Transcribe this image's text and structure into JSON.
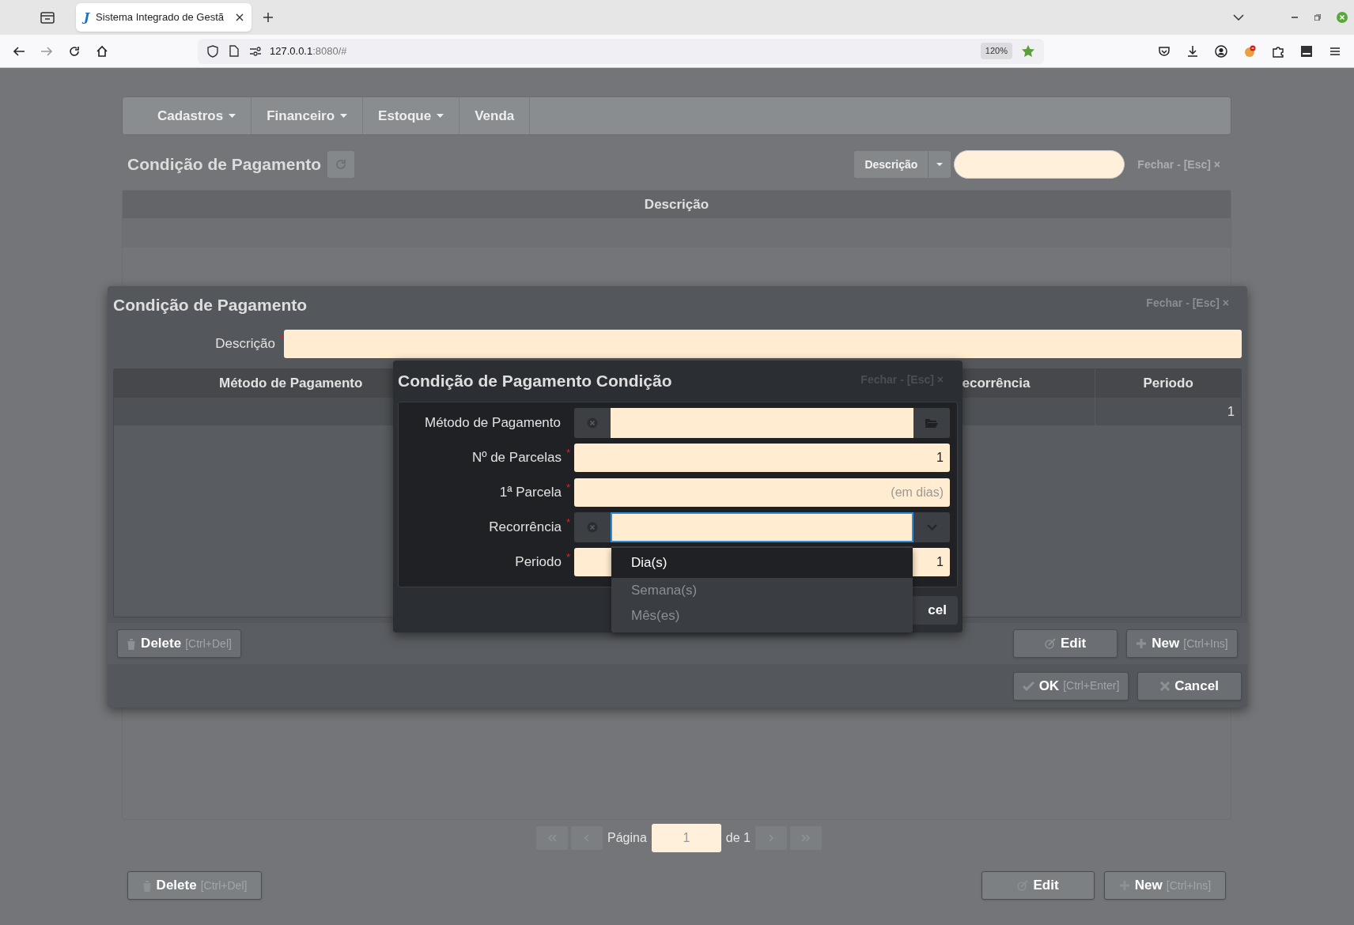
{
  "browser": {
    "tab_title": "Sistema Integrado de Gestã",
    "tab_letter": "J",
    "url_host": "127.0.0.1",
    "url_rest": ":8080/#",
    "zoom": "120%"
  },
  "navbar": {
    "items": [
      {
        "label": "Cadastros",
        "dropdown": true
      },
      {
        "label": "Financeiro",
        "dropdown": true
      },
      {
        "label": "Estoque",
        "dropdown": true
      },
      {
        "label": "Venda",
        "dropdown": false
      }
    ]
  },
  "page": {
    "title": "Condição de Pagamento",
    "search": {
      "field_button": "Descrição",
      "close": "Fechar - [Esc] ×"
    },
    "table": {
      "columns": [
        "Descrição"
      ]
    },
    "pagination": {
      "label": "Página",
      "page": "1",
      "of": "de 1"
    },
    "buttons": [
      {
        "label": "Delete",
        "shortcut": "[Ctrl+Del]",
        "kind": "delete"
      },
      {
        "label": "Edit",
        "kind": "edit"
      },
      {
        "label": "New",
        "shortcut": "[Ctrl+Ins]",
        "kind": "new"
      }
    ]
  },
  "dialog": {
    "title": "Condição de Pagamento",
    "close": "Fechar - [Esc] ×",
    "field": {
      "label": "Descrição",
      "required_mark": "*"
    },
    "grid": {
      "columns": [
        "Método de Pagamento",
        "ecorrência",
        "Periodo"
      ],
      "rows": [
        {
          "period": "1"
        }
      ]
    },
    "buttons": [
      {
        "label": "Delete",
        "shortcut": "[Ctrl+Del]",
        "kind": "delete"
      },
      {
        "label": "Edit",
        "kind": "edit"
      },
      {
        "label": "New",
        "shortcut": "[Ctrl+Ins]",
        "kind": "new"
      }
    ],
    "footer_buttons": [
      {
        "label": "OK",
        "shortcut": "[Ctrl+Enter]",
        "kind": "ok"
      },
      {
        "label": "Cancel",
        "kind": "cancel"
      }
    ]
  },
  "subdialog": {
    "title": "Condição de Pagamento Condição",
    "close": "Fechar - [Esc] ×",
    "fields": [
      {
        "label": "Método de Pagamento",
        "kind": "lookup",
        "focused": false
      },
      {
        "label": "Nº de Parcelas",
        "required_mark": "*",
        "kind": "number",
        "value": "1"
      },
      {
        "label": "1ª Parcela",
        "required_mark": "*",
        "kind": "number",
        "placeholder": "(em dias)"
      },
      {
        "label": "Recorrência",
        "required_mark": "*",
        "kind": "select",
        "focused": true
      },
      {
        "label": "Periodo",
        "required_mark": "*",
        "kind": "number",
        "value": "1"
      }
    ],
    "footer_button": "cel",
    "dropdown": {
      "options": [
        {
          "label": "Dia(s)",
          "selected": true
        },
        {
          "label": "Semana(s)",
          "selected": false
        },
        {
          "label": "Mês(es)",
          "selected": false
        }
      ]
    }
  }
}
